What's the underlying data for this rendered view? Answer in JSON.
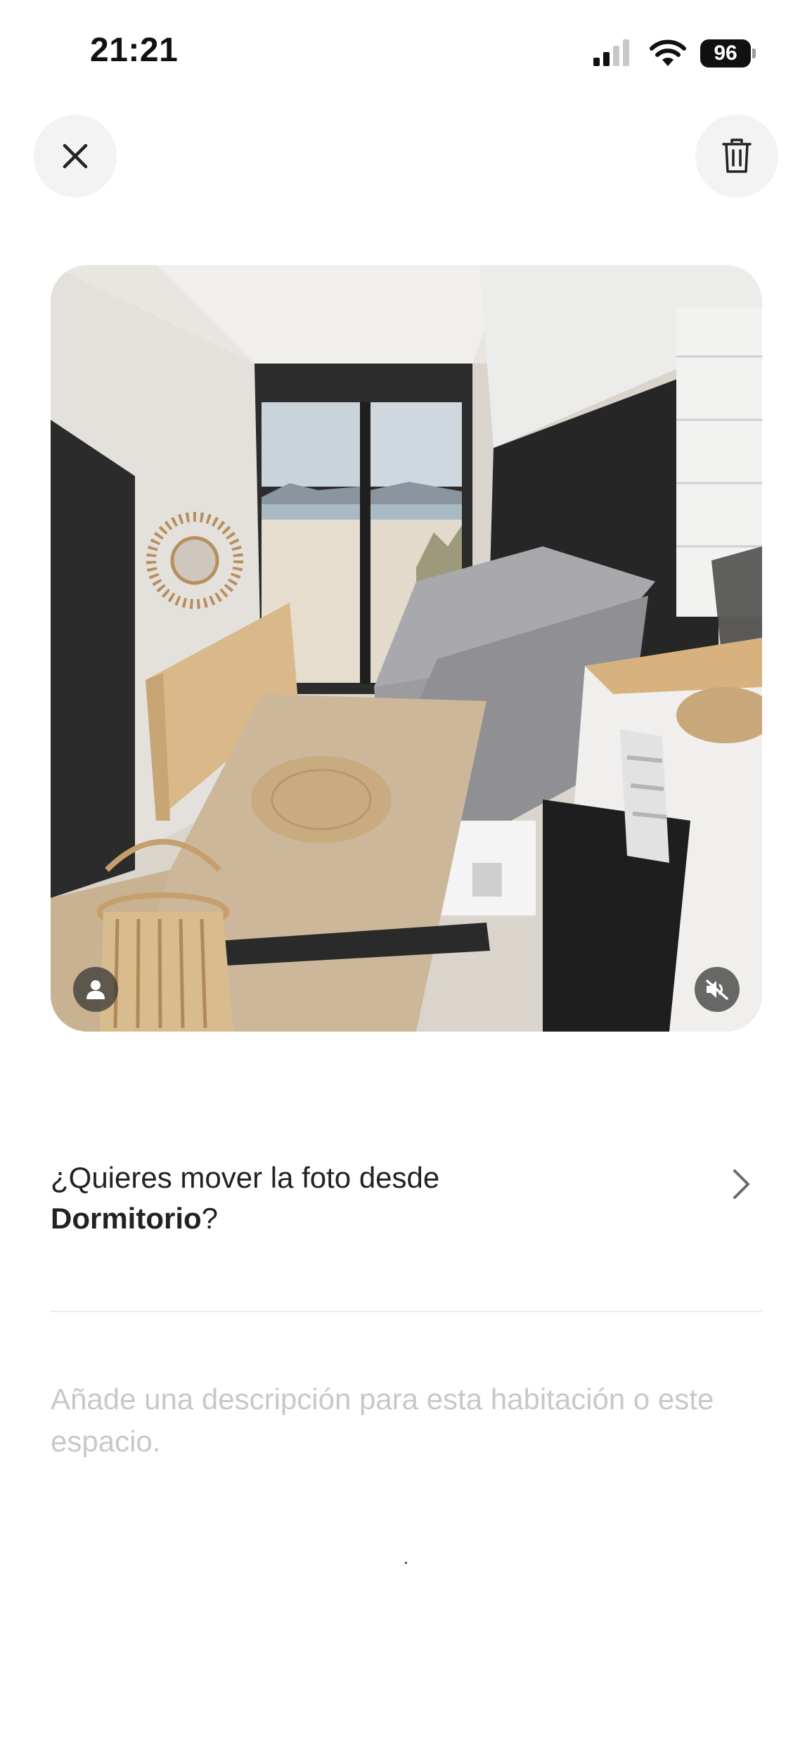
{
  "status_bar": {
    "time": "21:21",
    "battery": "96",
    "icons": [
      "cellular-signal-icon",
      "wifi-icon",
      "battery-icon"
    ]
  },
  "toolbar": {
    "close_icon": "close-icon",
    "delete_icon": "trash-icon"
  },
  "photo": {
    "person_icon": "person-icon",
    "mute_icon": "speaker-muted-icon"
  },
  "move_prompt": {
    "line1": "¿Quieres mover la foto desde",
    "room": "Dormitorio",
    "suffix": "?",
    "chevron_icon": "chevron-right-icon"
  },
  "description": {
    "placeholder": "Añade una descripción para esta habitación o este espacio."
  }
}
